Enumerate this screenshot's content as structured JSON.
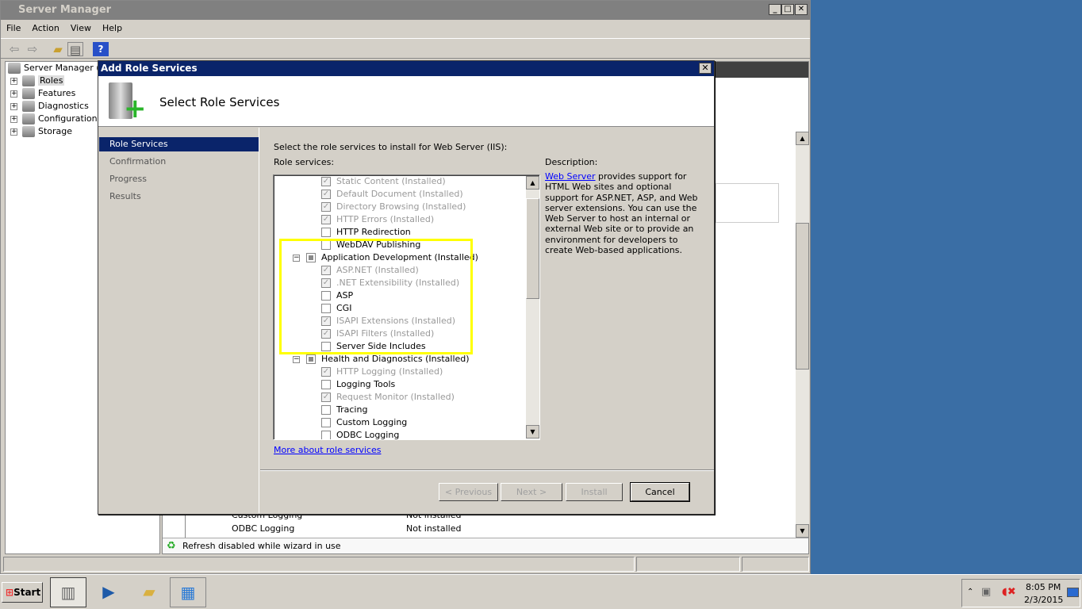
{
  "window": {
    "title": "Server Manager",
    "menu": [
      "File",
      "Action",
      "View",
      "Help"
    ]
  },
  "tree": {
    "root": "Server Manager (W",
    "items": [
      "Roles",
      "Features",
      "Diagnostics",
      "Configuration",
      "Storage"
    ]
  },
  "background_rows": [
    {
      "name": "Custom Logging",
      "status": "Not installed"
    },
    {
      "name": "ODBC Logging",
      "status": "Not installed"
    }
  ],
  "status_text": "Refresh disabled while wizard in use",
  "dialog": {
    "title": "Add Role Services",
    "heading": "Select Role Services",
    "steps": [
      "Role Services",
      "Confirmation",
      "Progress",
      "Results"
    ],
    "instruction": "Select the role services to install for Web Server (IIS):",
    "list_label": "Role services:",
    "items": [
      {
        "label": "Static Content  (Installed)",
        "level": 2,
        "state": "checked-disabled"
      },
      {
        "label": "Default Document  (Installed)",
        "level": 2,
        "state": "checked-disabled"
      },
      {
        "label": "Directory Browsing  (Installed)",
        "level": 2,
        "state": "checked-disabled"
      },
      {
        "label": "HTTP Errors  (Installed)",
        "level": 2,
        "state": "checked-disabled"
      },
      {
        "label": "HTTP Redirection",
        "level": 2,
        "state": "unchecked"
      },
      {
        "label": "WebDAV Publishing",
        "level": 2,
        "state": "unchecked"
      },
      {
        "label": "Application Development  (Installed)",
        "level": 1,
        "state": "mixed"
      },
      {
        "label": "ASP.NET  (Installed)",
        "level": 2,
        "state": "checked-disabled"
      },
      {
        "label": ".NET Extensibility  (Installed)",
        "level": 2,
        "state": "checked-disabled"
      },
      {
        "label": "ASP",
        "level": 2,
        "state": "unchecked"
      },
      {
        "label": "CGI",
        "level": 2,
        "state": "unchecked"
      },
      {
        "label": "ISAPI Extensions  (Installed)",
        "level": 2,
        "state": "checked-disabled"
      },
      {
        "label": "ISAPI Filters  (Installed)",
        "level": 2,
        "state": "checked-disabled"
      },
      {
        "label": "Server Side Includes",
        "level": 2,
        "state": "unchecked"
      },
      {
        "label": "Health and Diagnostics  (Installed)",
        "level": 1,
        "state": "mixed"
      },
      {
        "label": "HTTP Logging  (Installed)",
        "level": 2,
        "state": "checked-disabled"
      },
      {
        "label": "Logging Tools",
        "level": 2,
        "state": "unchecked"
      },
      {
        "label": "Request Monitor  (Installed)",
        "level": 2,
        "state": "checked-disabled"
      },
      {
        "label": "Tracing",
        "level": 2,
        "state": "unchecked"
      },
      {
        "label": "Custom Logging",
        "level": 2,
        "state": "unchecked"
      },
      {
        "label": "ODBC Logging",
        "level": 2,
        "state": "unchecked"
      }
    ],
    "more_link": "More about role services",
    "description_label": "Description:",
    "description_link": "Web Server",
    "description_text": " provides support for HTML Web sites and optional support for ASP.NET, ASP, and Web server extensions. You can use the Web Server to host an internal or external Web site or to provide an environment for developers to create Web-based applications.",
    "buttons": {
      "previous": "< Previous",
      "next": "Next >",
      "install": "Install",
      "cancel": "Cancel"
    },
    "highlight_color": "#ffff00"
  },
  "taskbar": {
    "start": "Start",
    "time": "8:05 PM",
    "date": "2/3/2015"
  }
}
